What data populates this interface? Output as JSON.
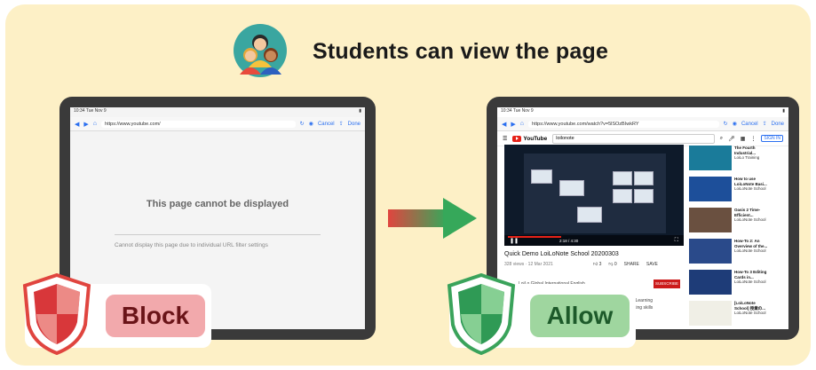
{
  "header": {
    "title": "Students can view the page",
    "icon": "students-group-icon"
  },
  "blocked_tablet": {
    "status_time": "10:34",
    "status_date": "Tue Nov 9",
    "url": "https://www.youtube.com/",
    "cancel_label": "Cancel",
    "done_label": "Done",
    "message_title": "This page cannot be displayed",
    "message_detail": "Cannot display this page due to individual URL filter settings"
  },
  "allowed_tablet": {
    "status_time": "10:34",
    "status_date": "Tue Nov 9",
    "url": "https://www.youtube.com/watch?v=5lSOzBIwkRY",
    "cancel_label": "Cancel",
    "done_label": "Done",
    "search_value": "loilonote",
    "sign_in_label": "SIGN IN",
    "logo_text": "YouTube",
    "video_title": "Quick Demo LoiLoNote School 20200303",
    "video_meta": "328 views · 12 Mar 2021",
    "like_count": "3",
    "dislike_count": "0",
    "share_label": "SHARE",
    "save_label": "SAVE",
    "subscribe_label": "SUBSCRIBE",
    "time_display": "2:18 / 4:30",
    "description_lines": [
      "LoiLo Global International English",
      "ntered Learning",
      "ur thinking skills"
    ],
    "sidebar": [
      {
        "title": "The Fourth Industrial...",
        "meta": "LoiLo Training"
      },
      {
        "title": "How to use LoiLoNote Basi...",
        "meta": "LoiLoNote School"
      },
      {
        "title": "Oasis 2 Time-Efficient...",
        "meta": "LoiLoNote School"
      },
      {
        "title": "How-To 2: An Overview of the...",
        "meta": "LoiLoNote School"
      },
      {
        "title": "How-To 3 Editing Cards in...",
        "meta": "LoiLoNote School"
      },
      {
        "title": "[LoiLoNote School] 授業の...",
        "meta": "LoiLoNote School"
      }
    ]
  },
  "labels": {
    "block": "Block",
    "allow": "Allow"
  },
  "colors": {
    "panel": "#fdf0c6",
    "block_red": "#e0453f",
    "block_pill": "#f2a9ac",
    "allow_green": "#3aa35b",
    "allow_pill": "#9fd69f",
    "yt_red": "#e62117"
  }
}
